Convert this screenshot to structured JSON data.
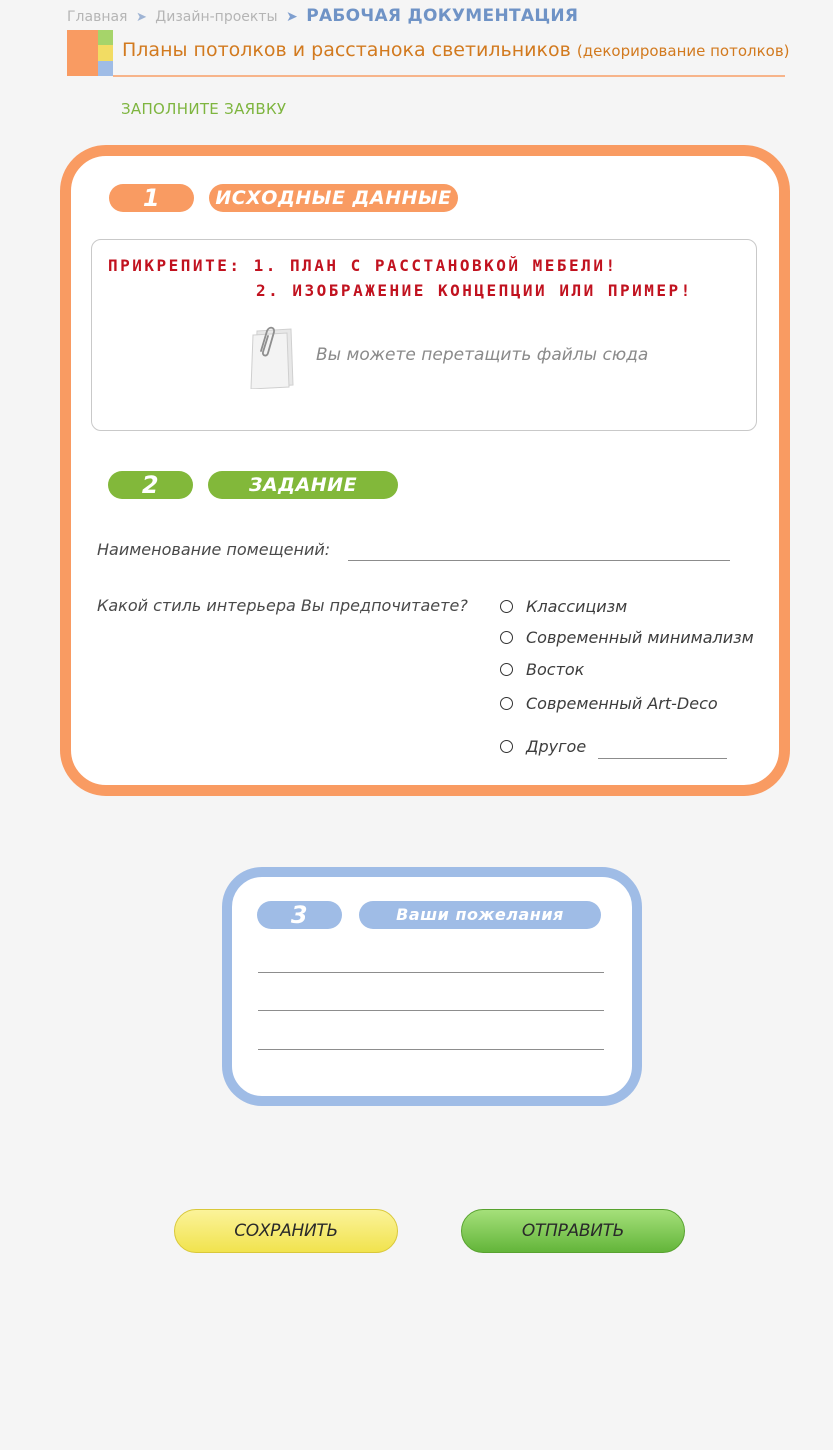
{
  "breadcrumb": {
    "items": [
      "Главная",
      "Дизайн-проекты"
    ],
    "current": "РАБОЧАЯ ДОКУМЕНТАЦИЯ",
    "separator": "➤"
  },
  "page": {
    "title": "Планы потолков и расстанока светильников",
    "subtitle": "(декорирование потолков)",
    "fill_request": "ЗАПОЛНИТЕ ЗАЯВКУ"
  },
  "section1": {
    "number": "1",
    "title": "ИСХОДНЫЕ ДАННЫЕ",
    "attach_line1": "ПРИКРЕПИТЕ: 1. ПЛАН С РАССТАНОВКОЙ МЕБЕЛИ!",
    "attach_line2": "2. ИЗОБРАЖЕНИЕ КОНЦЕПЦИИ ИЛИ ПРИМЕР!",
    "drop_text": "Вы можете перетащить файлы сюда",
    "icon": "paper-clip-icon"
  },
  "section2": {
    "number": "2",
    "title": "ЗАДАНИЕ",
    "rooms_label": "Наименование помещений:",
    "rooms_value": "",
    "style_question": "Какой стиль интерьера Вы предпочитаете?",
    "style_options": [
      "Классицизм",
      "Современный минимализм",
      "Восток",
      "Современный Art-Deco",
      "Другое"
    ],
    "other_value": ""
  },
  "section3": {
    "number": "3",
    "title": "Ваши пожелания",
    "lines": [
      "",
      "",
      ""
    ]
  },
  "buttons": {
    "save": "СОХРАНИТЬ",
    "send": "ОТПРАВИТЬ"
  },
  "colors": {
    "orange": "#f99b62",
    "green": "#82b83a",
    "blue": "#9fbce6",
    "yellow": "#f2dc63",
    "warning_red": "#c1121f"
  }
}
